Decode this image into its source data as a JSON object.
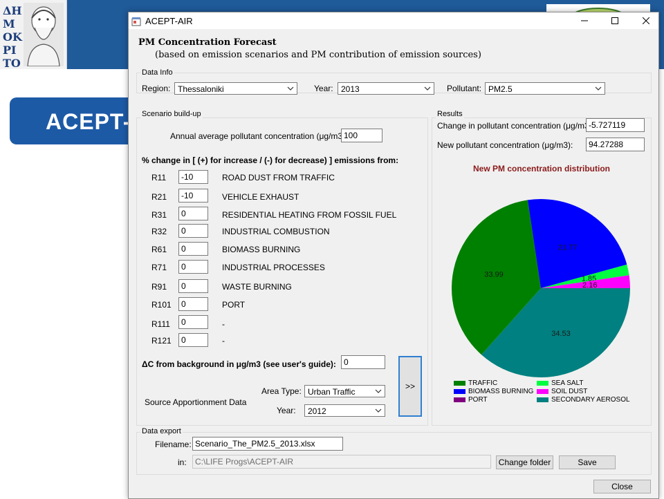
{
  "window": {
    "title": "ACEPT-AIR"
  },
  "background": {
    "banner_text": "ACEPT-",
    "logo_text": "ΔΗΜΟΚΡΙΤΟΣ"
  },
  "header": {
    "title": "PM Concentration Forecast",
    "subtitle": "(based on emission scenarios and PM contribution of emission sources)"
  },
  "data_info": {
    "label": "Data Info",
    "region_label": "Region:",
    "region": "Thessaloniki",
    "year_label": "Year:",
    "year": "2013",
    "pollutant_label": "Pollutant:",
    "pollutant": "PM2.5"
  },
  "scenario": {
    "label": "Scenario build-up",
    "annual_label": "Annual average pollutant concentration (μg/m3):",
    "annual_value": "100",
    "change_heading": "% change in [ (+) for increase / (-) for decrease) ] emissions from:",
    "rows": [
      {
        "code": "R11",
        "value": "-10",
        "name": "ROAD DUST FROM TRAFFIC"
      },
      {
        "code": "R21",
        "value": "-10",
        "name": "VEHICLE EXHAUST"
      },
      {
        "code": "R31",
        "value": "0",
        "name": "RESIDENTIAL HEATING FROM FOSSIL FUEL"
      },
      {
        "code": "R32",
        "value": "0",
        "name": "INDUSTRIAL COMBUSTION"
      },
      {
        "code": "R61",
        "value": "0",
        "name": "BIOMASS BURNING"
      },
      {
        "code": "R71",
        "value": "0",
        "name": "INDUSTRIAL PROCESSES"
      },
      {
        "code": "R91",
        "value": "0",
        "name": "WASTE BURNING"
      },
      {
        "code": "R101",
        "value": "0",
        "name": "PORT"
      },
      {
        "code": "R111",
        "value": "0",
        "name": "-"
      },
      {
        "code": "R121",
        "value": "0",
        "name": "-"
      }
    ],
    "delta_label": "ΔC from background in μg/m3 (see user's guide):",
    "delta_value": "0",
    "source_label": "Source Apportionment Data",
    "area_type_label": "Area Type:",
    "area_type": "Urban Traffic",
    "sa_year_label": "Year:",
    "sa_year": "2012",
    "go_label": ">>"
  },
  "results": {
    "label": "Results",
    "change_label": "Change in pollutant concentration (μg/m3):",
    "change_value": "-5.727119",
    "new_label": "New pollutant concentration (μg/m3):",
    "new_value": "94.27288"
  },
  "chart_data": {
    "type": "pie",
    "title": "New PM concentration distribution",
    "slices": [
      {
        "name": "SECONDARY AEROSOL",
        "value": 34.53,
        "label": "34.53",
        "color": "#008080"
      },
      {
        "name": "TRAFFIC",
        "value": 33.99,
        "label": "33.99",
        "color": "#008000"
      },
      {
        "name": "BIOMASS BURNING",
        "value": 21.77,
        "label": "21.77",
        "color": "#0000ff"
      },
      {
        "name": "SEA SALT",
        "value": 1.85,
        "label": "1.85",
        "color": "#00ff40"
      },
      {
        "name": "SOIL DUST",
        "value": 2.16,
        "label": "2.16",
        "color": "#ff00ff"
      },
      {
        "name": "PORT",
        "value": 0.03,
        "label": "",
        "color": "#800080"
      }
    ],
    "legend": [
      {
        "name": "TRAFFIC",
        "color": "#008000"
      },
      {
        "name": "SEA SALT",
        "color": "#00ff40"
      },
      {
        "name": "BIOMASS BURNING",
        "color": "#0000ff"
      },
      {
        "name": "SOIL DUST",
        "color": "#ff00ff"
      },
      {
        "name": "PORT",
        "color": "#800080"
      },
      {
        "name": "SECONDARY AEROSOL",
        "color": "#008080"
      }
    ],
    "legend_position": "bottom"
  },
  "export": {
    "label": "Data export",
    "filename_label": "Filename:",
    "filename": "Scenario_The_PM2.5_2013.xlsx",
    "in_label": "in:",
    "folder": "C:\\LIFE Progs\\ACEPT-AIR",
    "change_folder_label": "Change folder",
    "save_label": "Save"
  },
  "close_label": "Close"
}
